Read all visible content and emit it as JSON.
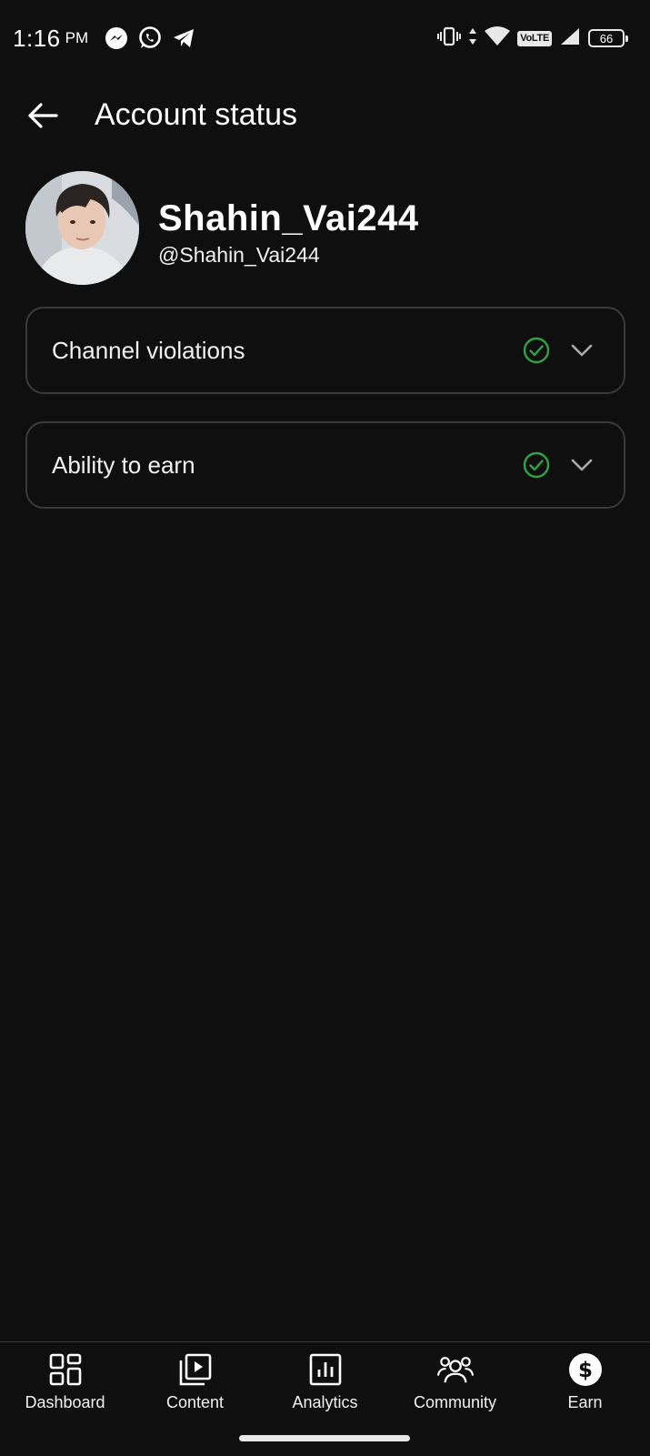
{
  "status_bar": {
    "time": "1:16",
    "ampm": "PM",
    "network_badge": "VoLTE",
    "battery_level": "66"
  },
  "header": {
    "title": "Account status"
  },
  "profile": {
    "name": "Shahin_Vai244",
    "handle": "@Shahin_Vai244"
  },
  "status_items": [
    {
      "label": "Channel violations",
      "status": "ok",
      "expanded": false
    },
    {
      "label": "Ability to earn",
      "status": "ok",
      "expanded": false
    }
  ],
  "bottom_nav": {
    "items": [
      {
        "label": "Dashboard",
        "icon": "dashboard-icon"
      },
      {
        "label": "Content",
        "icon": "content-icon"
      },
      {
        "label": "Analytics",
        "icon": "analytics-icon"
      },
      {
        "label": "Community",
        "icon": "community-icon"
      },
      {
        "label": "Earn",
        "icon": "earn-icon"
      }
    ]
  },
  "colors": {
    "background": "#0f0f0f",
    "text": "#ffffff",
    "card_border": "#3a3a3a",
    "check_green": "#2ba640",
    "chevron": "#aaaaaa"
  }
}
